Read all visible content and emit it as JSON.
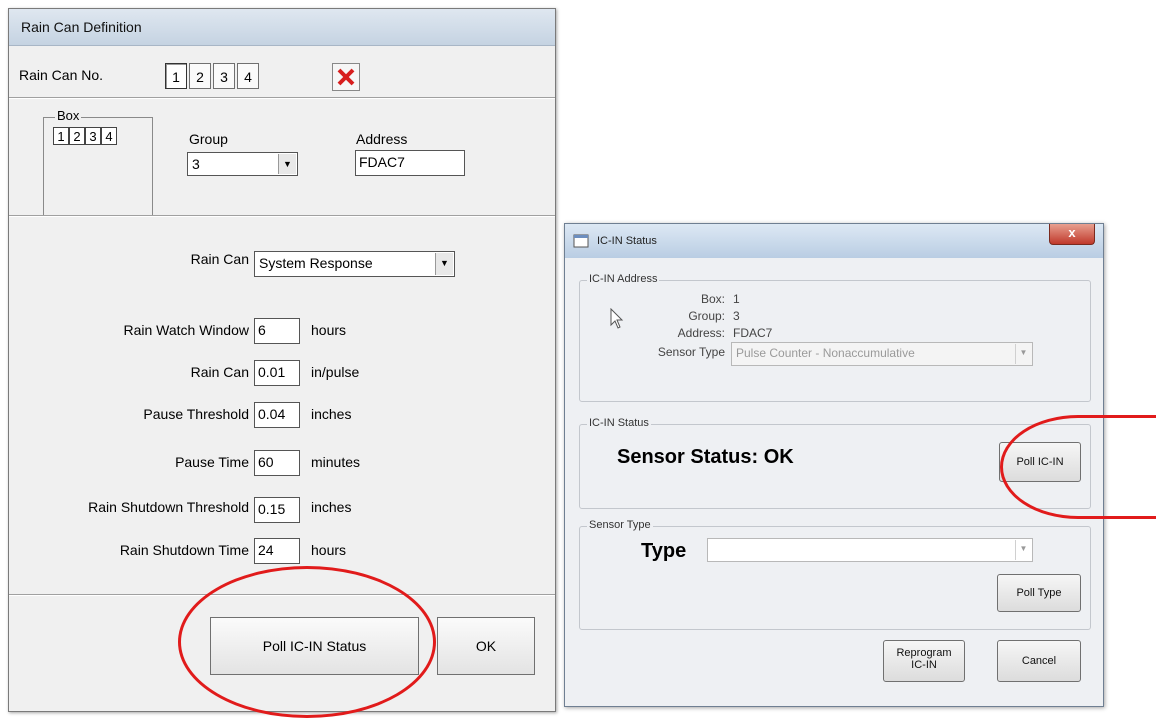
{
  "rain_can_definition": {
    "title": "Rain Can Definition",
    "rain_can_no_label": "Rain Can No.",
    "rain_can_numbers": [
      "1",
      "2",
      "3",
      "4"
    ],
    "selected_rain_can": "1",
    "box_label": "Box",
    "box_numbers": [
      "1",
      "2",
      "3",
      "4"
    ],
    "group_label": "Group",
    "group_value": "3",
    "address_label": "Address",
    "address_value": "FDAC7",
    "rain_can_type_label": "Rain Can",
    "rain_can_type_value": "System Response",
    "fields": [
      {
        "label": "Rain Watch Window",
        "value": "6",
        "unit": "hours"
      },
      {
        "label": "Rain Can",
        "value": "0.01",
        "unit": "in/pulse"
      },
      {
        "label": "Pause Threshold",
        "value": "0.04",
        "unit": "inches"
      },
      {
        "label": "Pause Time",
        "value": "60",
        "unit": "minutes"
      },
      {
        "label": "Rain Shutdown Threshold",
        "value": "0.15",
        "unit": "inches"
      },
      {
        "label": "Rain Shutdown Time",
        "value": "24",
        "unit": "hours"
      }
    ],
    "poll_button": "Poll IC-IN Status",
    "ok_button": "OK"
  },
  "ic_in_status": {
    "title": "IC-IN Status",
    "close_glyph": "x",
    "address_group_label": "IC-IN Address",
    "box_label": "Box:",
    "box_value": "1",
    "group_label": "Group:",
    "group_value": "3",
    "address_label": "Address:",
    "address_value": "FDAC7",
    "sensor_type_label": "Sensor Type",
    "sensor_type_value": "Pulse Counter - Nonaccumulative",
    "status_group_label": "IC-IN Status",
    "sensor_status_text": "Sensor Status: OK",
    "poll_icin_button": "Poll IC-IN",
    "sensor_type_group_label": "Sensor Type",
    "type_label": "Type",
    "type_value": "",
    "poll_type_button": "Poll Type",
    "reprogram_button_line1": "Reprogram",
    "reprogram_button_line2": "IC-IN",
    "cancel_button": "Cancel"
  },
  "highlight_color": "#e11b1b"
}
